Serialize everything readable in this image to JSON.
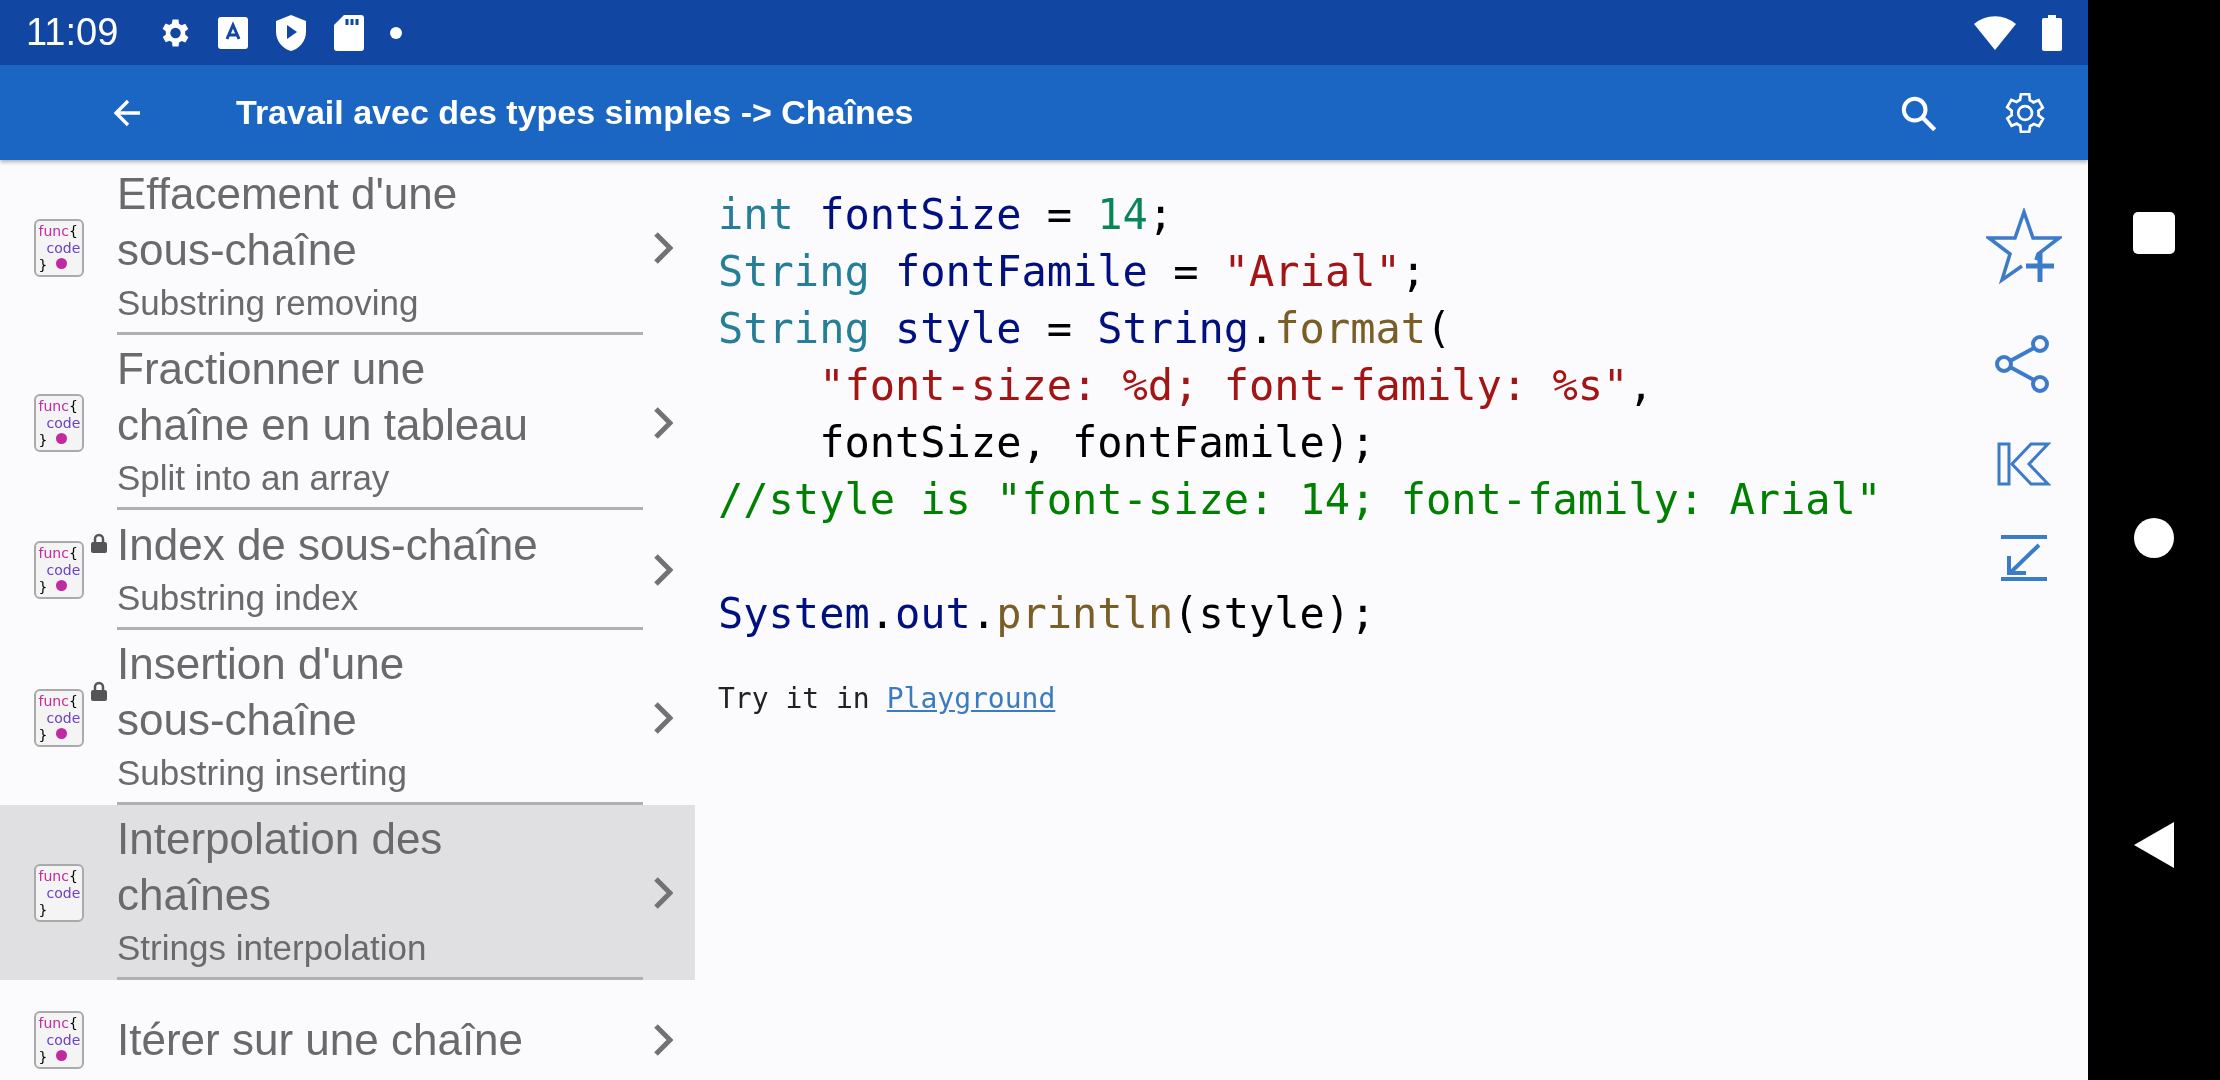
{
  "status_bar": {
    "time": "11:09"
  },
  "app_bar": {
    "title": "Travail avec des types simples -> Chaînes"
  },
  "items": [
    {
      "title": "Effacement d'une sous-chaîne",
      "subtitle": "Substring removing",
      "locked": false,
      "dot": true,
      "selected": false,
      "icon_text": [
        "func",
        "{",
        "code",
        "}"
      ]
    },
    {
      "title": "Fractionner une chaîne en un tableau",
      "subtitle": "Split into an array",
      "locked": false,
      "dot": true,
      "selected": false,
      "icon_text": [
        "func",
        "{",
        "code",
        "}"
      ]
    },
    {
      "title": "Index de sous-chaîne",
      "subtitle": "Substring index",
      "locked": true,
      "dot": true,
      "selected": false,
      "icon_text": [
        "func",
        "{",
        "code",
        "}"
      ]
    },
    {
      "title": "Insertion d'une sous-chaîne",
      "subtitle": "Substring inserting",
      "locked": true,
      "dot": true,
      "selected": false,
      "icon_text": [
        "func",
        "{",
        "code",
        "}"
      ]
    },
    {
      "title": "Interpolation des chaînes",
      "subtitle": "Strings interpolation",
      "locked": false,
      "dot": false,
      "selected": true,
      "icon_text": [
        "func",
        "{",
        "code",
        "}"
      ]
    },
    {
      "title": "Itérer sur une chaîne",
      "locked": false,
      "dot": true,
      "selected": false,
      "icon_text": [
        "func",
        "{",
        "code",
        "}"
      ]
    }
  ],
  "code": {
    "lines": [
      {
        "spaced": false,
        "tokens": [
          {
            "kind": "type",
            "text": "int"
          },
          {
            "kind": "var",
            "text": " fontSize"
          },
          {
            "kind": "op",
            "text": " = "
          },
          {
            "kind": "num",
            "text": "14"
          },
          {
            "kind": "op",
            "text": ";"
          }
        ]
      },
      {
        "spaced": false,
        "tokens": [
          {
            "kind": "type",
            "text": "String"
          },
          {
            "kind": "var",
            "text": " fontFamile"
          },
          {
            "kind": "op",
            "text": " = "
          },
          {
            "kind": "str",
            "text": "\"Arial\""
          },
          {
            "kind": "op",
            "text": ";"
          }
        ]
      },
      {
        "spaced": false,
        "tokens": [
          {
            "kind": "type",
            "text": "String"
          },
          {
            "kind": "var",
            "text": " style"
          },
          {
            "kind": "op",
            "text": " = "
          },
          {
            "kind": "var",
            "text": "String"
          },
          {
            "kind": "op",
            "text": "."
          },
          {
            "kind": "fn",
            "text": "format"
          },
          {
            "kind": "op",
            "text": "("
          }
        ]
      },
      {
        "spaced": false,
        "tokens": [
          {
            "kind": "str",
            "text": "    \"font-size: %d; font-family: %s\""
          },
          {
            "kind": "op",
            "text": ","
          }
        ]
      },
      {
        "spaced": false,
        "tokens": [
          {
            "kind": "op",
            "text": "    fontSize, fontFamile);"
          }
        ]
      },
      {
        "spaced": false,
        "tokens": [
          {
            "kind": "comment",
            "text": "//style is \"font-size: 14; font-family: Arial\""
          }
        ]
      },
      {
        "spaced": true,
        "tokens": [
          {
            "kind": "var",
            "text": "System"
          },
          {
            "kind": "op",
            "text": "."
          },
          {
            "kind": "var",
            "text": "out"
          },
          {
            "kind": "op",
            "text": "."
          },
          {
            "kind": "fn",
            "text": "println"
          },
          {
            "kind": "op",
            "text": "(style);"
          }
        ]
      }
    ],
    "try_text": "Try it in",
    "try_link": "Playground"
  }
}
